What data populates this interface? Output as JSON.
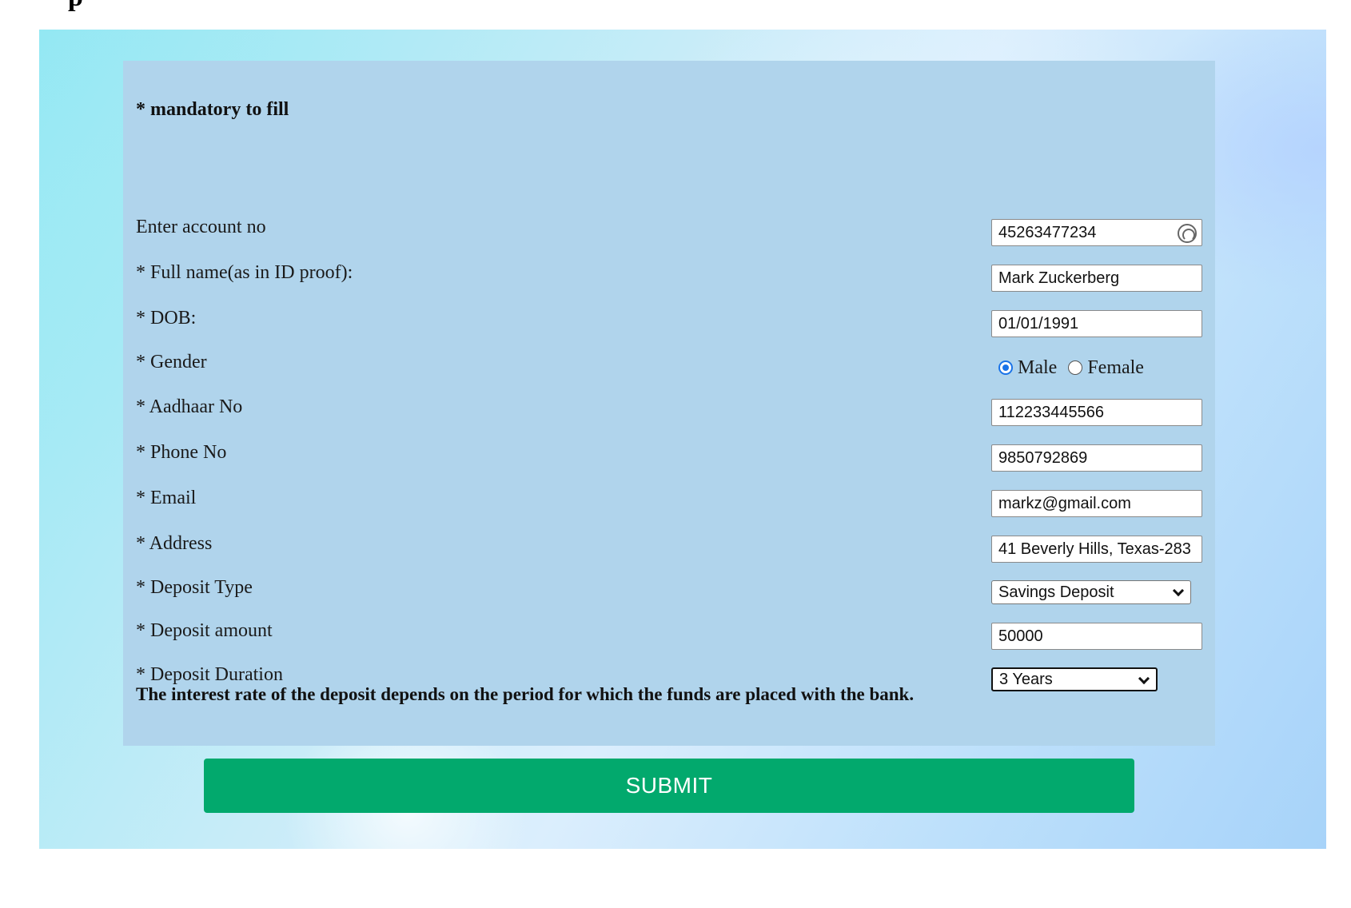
{
  "page": {
    "mandatory_note": "* mandatory to fill",
    "interest_note": "The interest rate of the deposit depends on the period for which the funds are placed with the bank."
  },
  "form": {
    "account": {
      "label": "Enter account no",
      "value": "45263477234"
    },
    "full_name": {
      "label": "* Full name(as in ID proof):",
      "value": "Mark Zuckerberg"
    },
    "dob": {
      "label": "* DOB:",
      "value": "01/01/1991"
    },
    "gender": {
      "label": "* Gender",
      "options": [
        "Male",
        "Female"
      ],
      "selected": "Male"
    },
    "aadhaar": {
      "label": "* Aadhaar No",
      "value": "112233445566"
    },
    "phone": {
      "label": "* Phone No",
      "value": "9850792869"
    },
    "email": {
      "label": "* Email",
      "value": "markz@gmail.com"
    },
    "address": {
      "label": "* Address",
      "value": "41 Beverly Hills, Texas-283"
    },
    "deposit_type": {
      "label": "* Deposit Type",
      "selected": "Savings Deposit"
    },
    "deposit_amount": {
      "label": "* Deposit amount",
      "value": "50000"
    },
    "deposit_duration": {
      "label": "* Deposit Duration",
      "selected": "3 Years"
    }
  },
  "actions": {
    "submit_label": "SUBMIT"
  },
  "colors": {
    "card": "#b0d4ec",
    "submit": "#02a96d",
    "radio_accent": "#1a73e8"
  }
}
